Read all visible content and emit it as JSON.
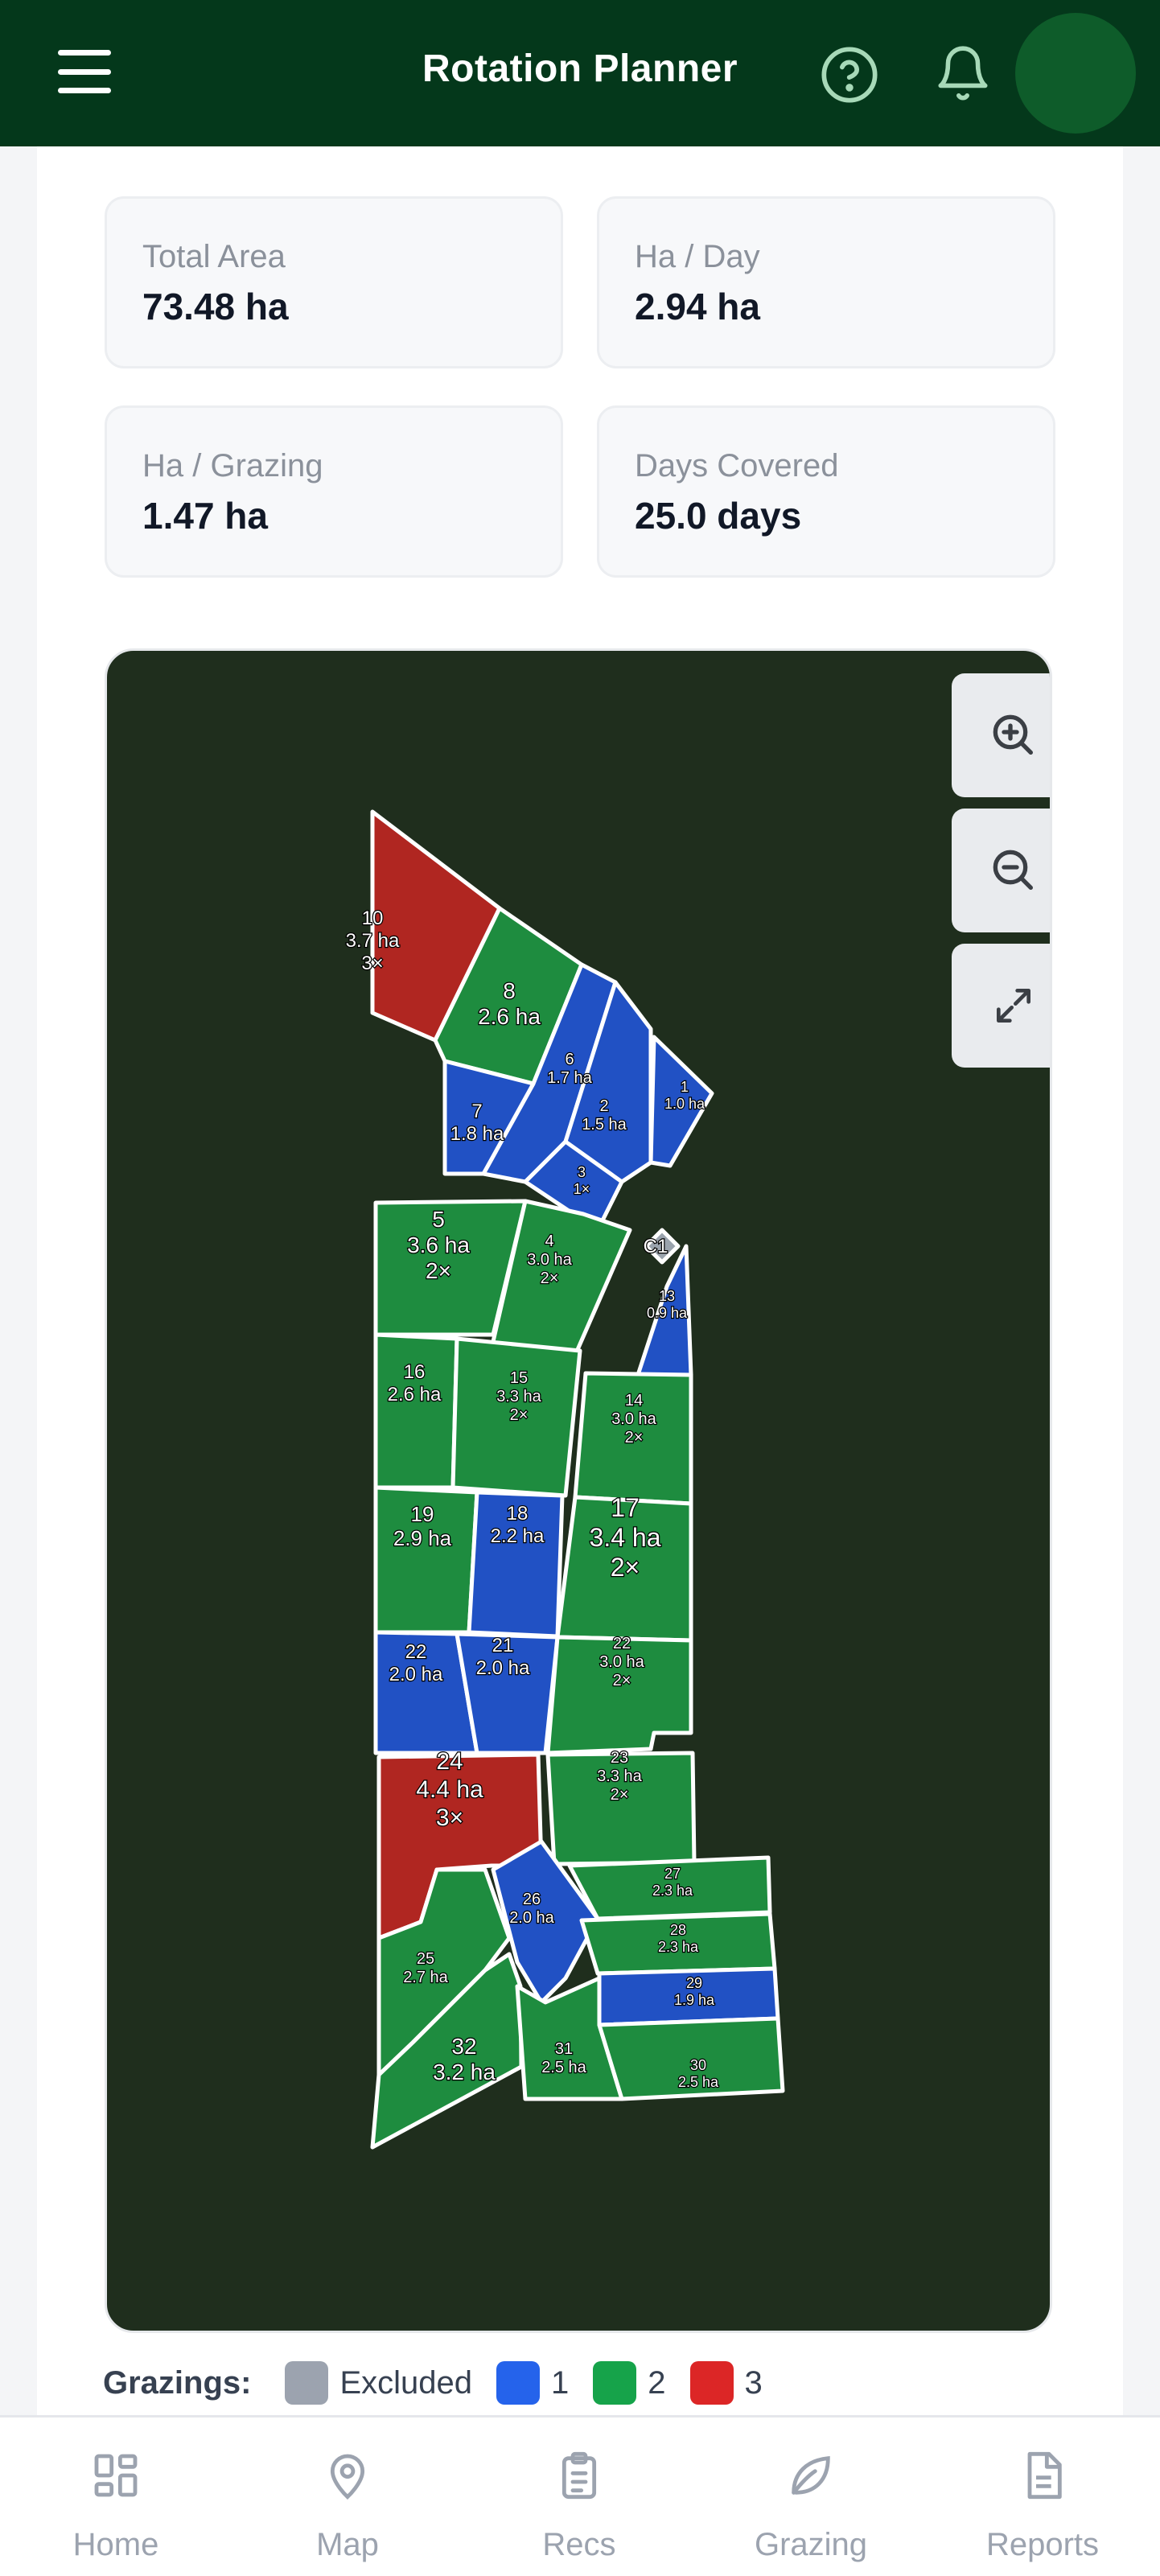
{
  "header": {
    "title": "Rotation Planner",
    "icons": {
      "menu": "menu-icon",
      "help": "help-circle-icon",
      "notifications": "bell-icon",
      "avatar": "avatar"
    }
  },
  "stats": [
    {
      "label": "Total Area",
      "value": "73.48 ha"
    },
    {
      "label": "Ha / Day",
      "value": "2.94 ha"
    },
    {
      "label": "Ha / Grazing",
      "value": "1.47 ha"
    },
    {
      "label": "Days Covered",
      "value": "25.0 days"
    }
  ],
  "map": {
    "controls": [
      "zoom-in-icon",
      "zoom-out-icon",
      "fullscreen-icon"
    ],
    "paddocks": [
      {
        "id": "10",
        "area": "3.7 ha",
        "grazings": "3×"
      },
      {
        "id": "8",
        "area": "2.6 ha",
        "grazings": ""
      },
      {
        "id": "6",
        "area": "1.7 ha",
        "grazings": ""
      },
      {
        "id": "1",
        "area": "1.0 ha",
        "grazings": ""
      },
      {
        "id": "7",
        "area": "1.8 ha",
        "grazings": ""
      },
      {
        "id": "2",
        "area": "1.5 ha",
        "grazings": ""
      },
      {
        "id": "3",
        "area": "",
        "grazings": "1×"
      },
      {
        "id": "C1",
        "area": "",
        "grazings": ""
      },
      {
        "id": "5",
        "area": "3.6 ha",
        "grazings": "2×"
      },
      {
        "id": "4",
        "area": "3.0 ha",
        "grazings": "2×"
      },
      {
        "id": "13",
        "area": "0.9 ha",
        "grazings": ""
      },
      {
        "id": "16",
        "area": "2.6 ha",
        "grazings": ""
      },
      {
        "id": "15",
        "area": "3.3 ha",
        "grazings": "2×"
      },
      {
        "id": "14",
        "area": "3.0 ha",
        "grazings": "2×"
      },
      {
        "id": "19",
        "area": "2.9 ha",
        "grazings": ""
      },
      {
        "id": "18",
        "area": "2.2 ha",
        "grazings": ""
      },
      {
        "id": "17",
        "area": "3.4 ha",
        "grazings": "2×"
      },
      {
        "id": "22",
        "area": "2.0 ha",
        "grazings": ""
      },
      {
        "id": "21",
        "area": "2.0 ha",
        "grazings": ""
      },
      {
        "id": "22",
        "area": "3.0 ha",
        "grazings": "2×"
      },
      {
        "id": "24",
        "area": "4.4 ha",
        "grazings": "3×"
      },
      {
        "id": "23",
        "area": "3.3 ha",
        "grazings": "2×"
      },
      {
        "id": "27",
        "area": "2.3 ha",
        "grazings": ""
      },
      {
        "id": "26",
        "area": "2.0 ha",
        "grazings": ""
      },
      {
        "id": "28",
        "area": "2.3 ha",
        "grazings": ""
      },
      {
        "id": "25",
        "area": "2.7 ha",
        "grazings": ""
      },
      {
        "id": "29",
        "area": "1.9 ha",
        "grazings": ""
      },
      {
        "id": "32",
        "area": "3.2 ha",
        "grazings": ""
      },
      {
        "id": "31",
        "area": "2.5 ha",
        "grazings": ""
      },
      {
        "id": "30",
        "area": "2.5 ha",
        "grazings": ""
      }
    ]
  },
  "legend": {
    "title": "Grazings:",
    "items": [
      {
        "label": "Excluded",
        "color": "#9ca3af"
      },
      {
        "label": "1",
        "color": "#2563eb"
      },
      {
        "label": "2",
        "color": "#16a34a"
      },
      {
        "label": "3",
        "color": "#dc2626"
      }
    ]
  },
  "colors": {
    "header": "#04381b",
    "blue": "#2151c4",
    "green": "#1e8c3f",
    "red": "#b02621"
  },
  "nav": [
    {
      "label": "Home",
      "icon": "home-grid-icon"
    },
    {
      "label": "Map",
      "icon": "map-pin-icon"
    },
    {
      "label": "Recs",
      "icon": "clipboard-icon"
    },
    {
      "label": "Grazing",
      "icon": "leaf-icon"
    },
    {
      "label": "Reports",
      "icon": "document-icon"
    }
  ]
}
